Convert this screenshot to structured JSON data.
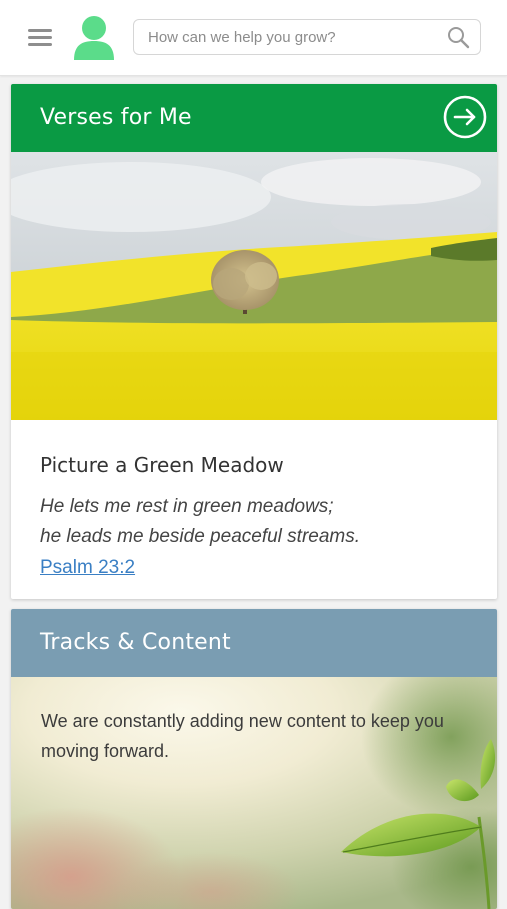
{
  "search": {
    "placeholder": "How can we help you grow?",
    "value": ""
  },
  "icons": {
    "menu": "hamburger-menu-icon",
    "avatar": "user-avatar-icon",
    "search": "magnifier-search-icon",
    "arrow": "arrow-right-circle-icon",
    "leaf": "plant-sprout-illustration"
  },
  "colors": {
    "brand_green": "#0a9a44",
    "avatar_green": "#5bdc8a",
    "tracks_header": "#7a9db2",
    "link_blue": "#3a7fc4"
  },
  "verses_card": {
    "header_title": "Verses for Me",
    "verse_title": "Picture a Green Meadow",
    "verse_lines": [
      "He lets me rest in green meadows;",
      "he leads me beside peaceful streams."
    ],
    "reference": "Psalm 23:2"
  },
  "tracks_card": {
    "header_title": "Tracks & Content",
    "description": "We are constantly adding new content to keep you moving forward."
  }
}
